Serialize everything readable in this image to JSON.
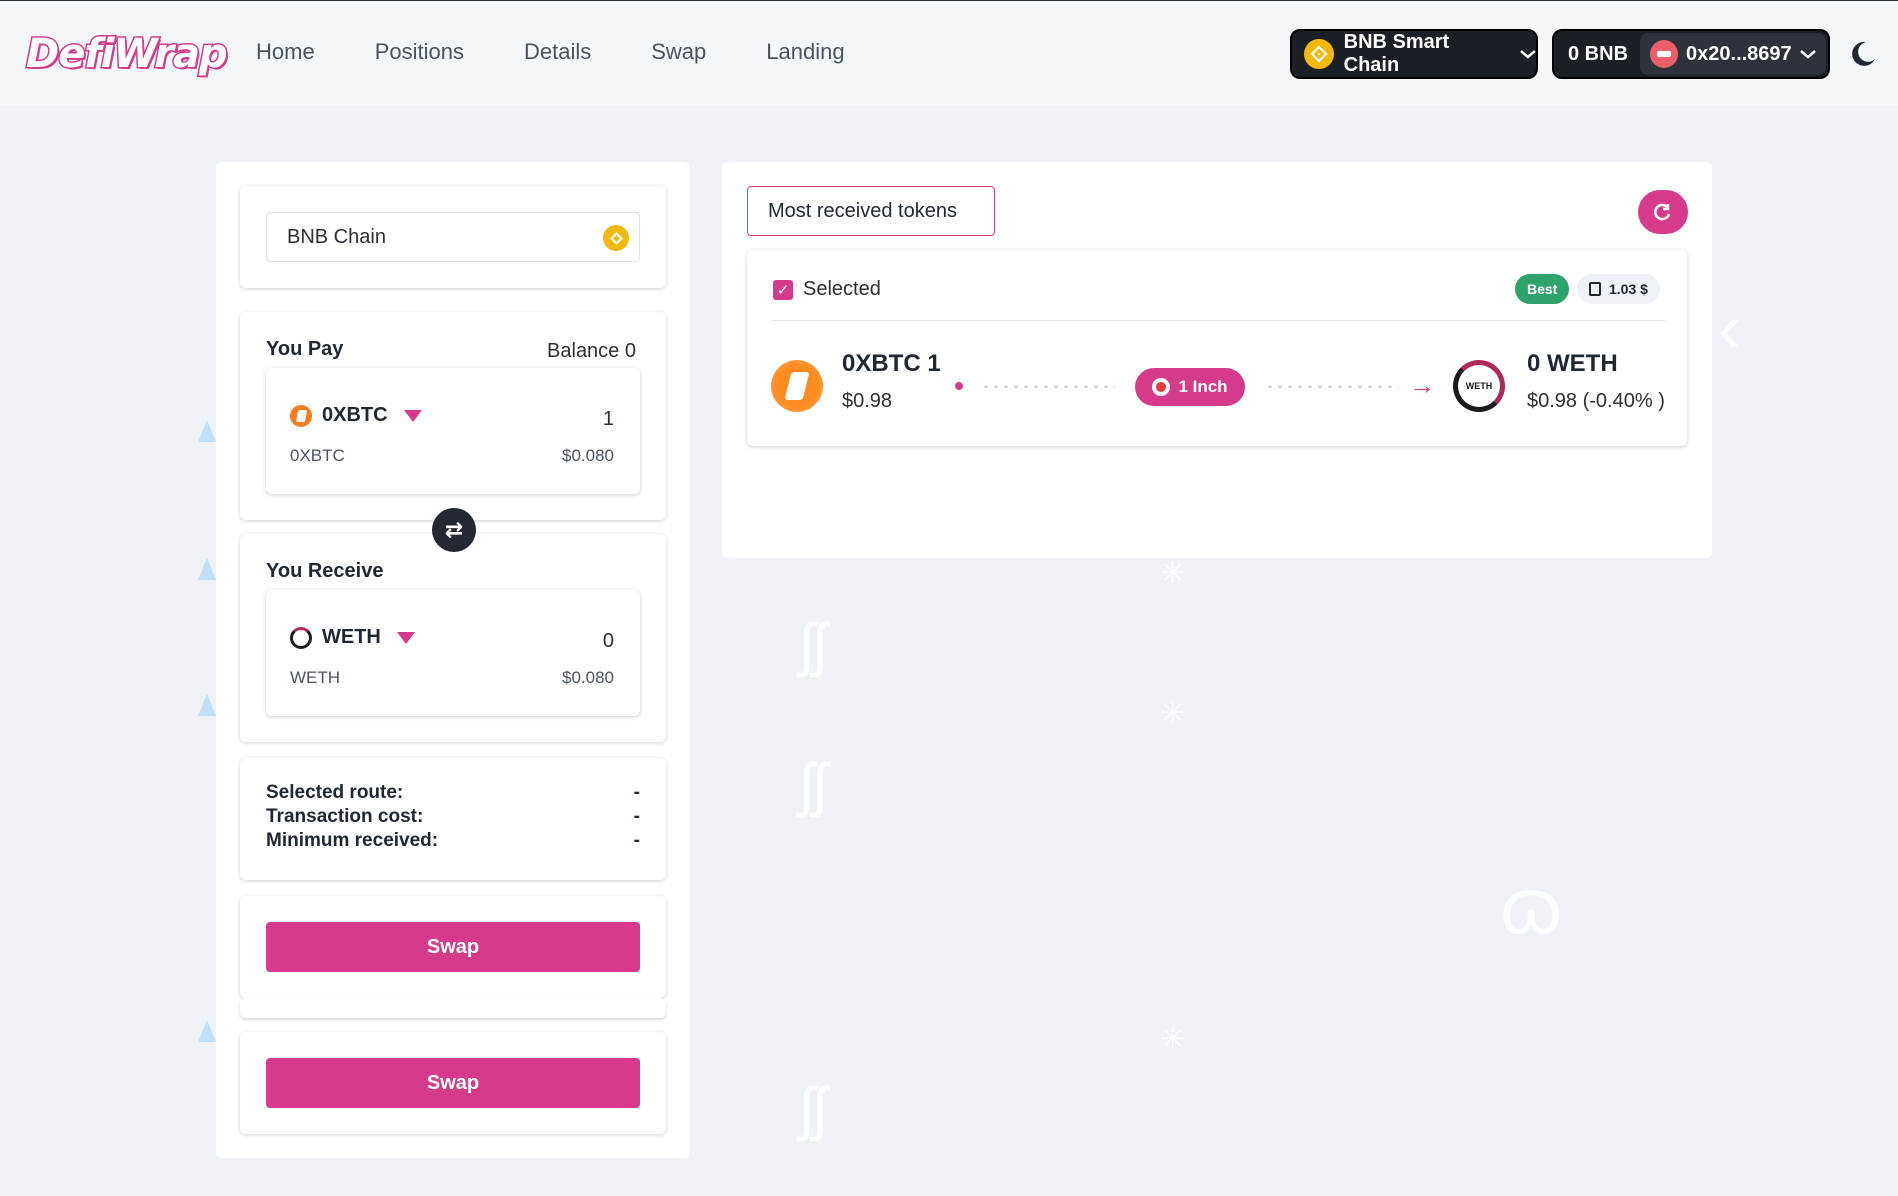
{
  "header": {
    "logo": "DefiWrap",
    "nav": [
      "Home",
      "Positions",
      "Details",
      "Swap",
      "Landing"
    ],
    "chain_button": "BNB Smart Chain",
    "wallet_balance": "0 BNB",
    "wallet_address": "0x20...8697"
  },
  "left": {
    "chain_select": "BNB Chain",
    "pay": {
      "title": "You Pay",
      "balance": "Balance 0",
      "token": "0XBTC",
      "amount": "1",
      "sub": "0XBTC",
      "usd": "$0.080"
    },
    "receive": {
      "title": "You Receive",
      "token": "WETH",
      "amount": "0",
      "sub": "WETH",
      "usd": "$0.080"
    },
    "info": [
      {
        "label": "Selected route:",
        "value": "-"
      },
      {
        "label": "Transaction cost:",
        "value": "-"
      },
      {
        "label": "Minimum received:",
        "value": "-"
      }
    ],
    "swap_label": "Swap"
  },
  "right": {
    "tab": "Most received tokens",
    "route": {
      "selected_label": "Selected",
      "best_badge": "Best",
      "gas": "1.03 $",
      "from_amount": "0XBTC 1",
      "from_usd": "$0.98",
      "protocol": "1 Inch",
      "to_amount": "0 WETH",
      "to_usd": "$0.98 (-0.40% )",
      "weth_icon_text": "WETH"
    }
  },
  "colors": {
    "accent": "#d63a8a",
    "dark_button": "#1b1f26",
    "background": "#eef2f7",
    "best_green": "#2ea36b",
    "bnb_yellow": "#f0b90b",
    "oxbtc_orange": "#f57c1f"
  },
  "icons": [
    "bnb-icon",
    "avatar-icon",
    "moon-icon",
    "oxbtc-icon",
    "weth-icon",
    "swap-arrows-icon",
    "refresh-icon",
    "checkbox-icon",
    "gas-pump-icon",
    "oneinch-icon",
    "arrow-right-icon",
    "caret-down-icon"
  ]
}
